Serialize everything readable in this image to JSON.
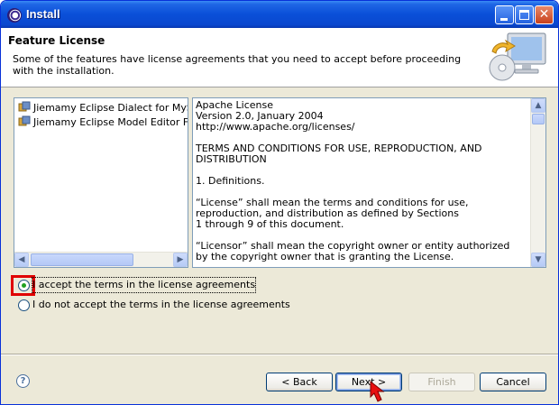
{
  "window": {
    "title": "Install"
  },
  "banner": {
    "title": "Feature License",
    "description": "Some of the features have license agreements that you need to accept before proceeding with the installation."
  },
  "features": [
    {
      "label": "Jiemamy Eclipse Dialect for MySQL"
    },
    {
      "label": "Jiemamy Eclipse Model Editor Feature"
    }
  ],
  "license": {
    "text": "Apache License\nVersion 2.0, January 2004\nhttp://www.apache.org/licenses/\n\nTERMS AND CONDITIONS FOR USE, REPRODUCTION, AND\nDISTRIBUTION\n\n1. Definitions.\n\n“License” shall mean the terms and conditions for use,\nreproduction, and distribution as defined by Sections\n1 through 9 of this document.\n\n“Licensor” shall mean the copyright owner or entity authorized\nby the copyright owner that is granting the License."
  },
  "radios": {
    "accept": {
      "label": "I accept the terms in the license agreements",
      "checked": true
    },
    "decline": {
      "label": "I do not accept the terms in the license agreements",
      "checked": false
    }
  },
  "buttons": {
    "back": "< Back",
    "next": "Next >",
    "finish": "Finish",
    "cancel": "Cancel"
  },
  "icons": {
    "help": "help-icon",
    "app": "eclipse-icon"
  },
  "colors": {
    "titlebar": "#0a4fd8",
    "highlight": "#e00000",
    "dialog_bg": "#ece9d8"
  }
}
